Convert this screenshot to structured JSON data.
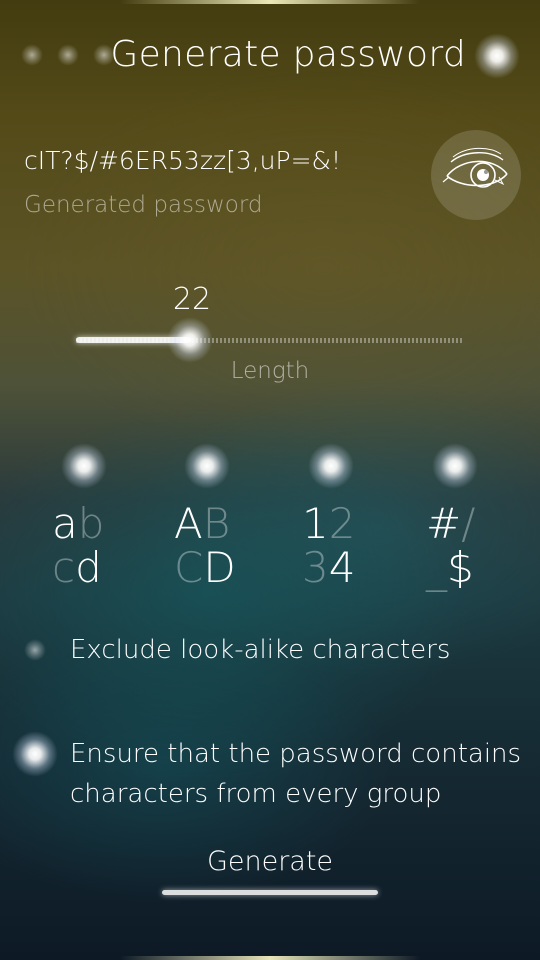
{
  "page": {
    "title": "Generate password"
  },
  "password": {
    "value": "cIT?$/#6ER53zz[3,uP=&!",
    "label": "Generated password"
  },
  "length": {
    "value": "22",
    "label": "Length",
    "level_fraction": 0.25
  },
  "groups": [
    {
      "row1": [
        "a",
        "b"
      ],
      "row2": [
        "c",
        "d"
      ],
      "enabled": true
    },
    {
      "row1": [
        "A",
        "B"
      ],
      "row2": [
        "C",
        "D"
      ],
      "enabled": true
    },
    {
      "row1": [
        "1",
        "2"
      ],
      "row2": [
        "3",
        "4"
      ],
      "enabled": true
    },
    {
      "row1": [
        "#",
        "/"
      ],
      "row2": [
        "_",
        "$"
      ],
      "enabled": true
    }
  ],
  "options": {
    "exclude_lookalike": {
      "label": "Exclude look-alike characters",
      "enabled": false
    },
    "every_group": {
      "line1": "Ensure that the password contains",
      "line2": "characters from every group",
      "enabled": true
    }
  },
  "generate": {
    "label": "Generate"
  },
  "icons": {
    "menu": "menu-dots-icon",
    "visibility": "eye-icon"
  }
}
